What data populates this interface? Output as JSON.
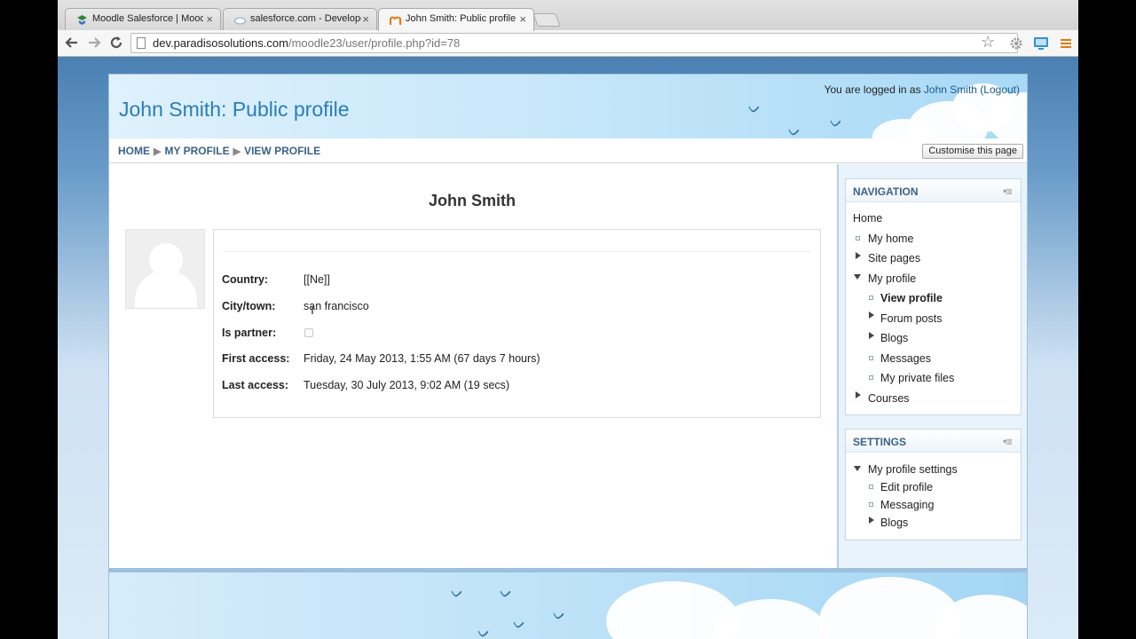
{
  "browser": {
    "tabs": [
      {
        "title": "Moodle Salesforce | Mood",
        "favicon": "moodle-icon"
      },
      {
        "title": "salesforce.com - Develope",
        "favicon": "cloud-icon"
      },
      {
        "title": "John Smith: Public profile",
        "favicon": "moodle-m-icon",
        "active": true
      }
    ],
    "close_glyph": "×",
    "url_host": "dev.paradisosolutions.com",
    "url_path": "/moodle23/user/profile.php?id=78"
  },
  "header": {
    "site_title": "John Smith: Public profile",
    "login_prefix": "You are logged in as ",
    "login_user": "John Smith",
    "logout": "(Logout)"
  },
  "breadcrumb": {
    "items": [
      "HOME",
      "MY PROFILE",
      "VIEW PROFILE"
    ],
    "separator": "▶"
  },
  "customise_button": "Customise this page",
  "profile": {
    "name": "John Smith",
    "fields": {
      "country": {
        "label": "Country:",
        "value": "[[Ne]]"
      },
      "city": {
        "label": "City/town:",
        "value": "san francisco"
      },
      "partner": {
        "label": "Is partner:",
        "value": ""
      },
      "first_access": {
        "label": "First access:",
        "value": "Friday, 24 May 2013, 1:55 AM  (67 days 7 hours)"
      },
      "last_access": {
        "label": "Last access:",
        "value": "Tuesday, 30 July 2013, 9:02 AM  (19 secs)"
      }
    }
  },
  "navigation": {
    "title": "NAVIGATION",
    "home": "Home",
    "my_home": "My home",
    "site_pages": "Site pages",
    "my_profile": "My profile",
    "view_profile": "View profile",
    "forum_posts": "Forum posts",
    "blogs": "Blogs",
    "messages": "Messages",
    "my_private_files": "My private files",
    "courses": "Courses"
  },
  "settings": {
    "title": "SETTINGS",
    "my_profile_settings": "My profile settings",
    "edit_profile": "Edit profile",
    "messaging": "Messaging",
    "blogs": "Blogs"
  },
  "colors": {
    "link_blue": "#3d6286",
    "title_blue": "#2a7db8",
    "page_bg": "#4b7fb0"
  }
}
